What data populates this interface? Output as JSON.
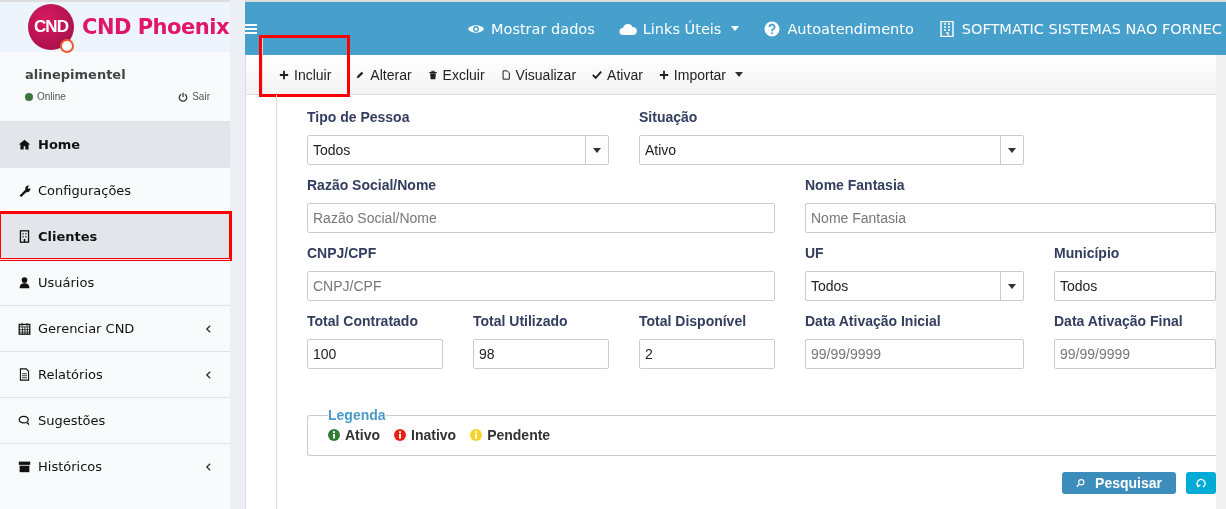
{
  "brand": {
    "logo_text": "CND",
    "name": "CND Phoenix"
  },
  "user": {
    "name": "alinepimentel",
    "status": "Online",
    "logout": "Sair"
  },
  "sidebar": {
    "items": [
      {
        "label": "Home",
        "selected": true,
        "highlighted": false,
        "submenu": false
      },
      {
        "label": "Configurações",
        "selected": false,
        "highlighted": false,
        "submenu": false
      },
      {
        "label": "Clientes",
        "selected": true,
        "highlighted": true,
        "submenu": false
      },
      {
        "label": "Usuários",
        "selected": false,
        "highlighted": false,
        "submenu": false
      },
      {
        "label": "Gerenciar CND",
        "selected": false,
        "highlighted": false,
        "submenu": true
      },
      {
        "label": "Relatórios",
        "selected": false,
        "highlighted": false,
        "submenu": true
      },
      {
        "label": "Sugestões",
        "selected": false,
        "highlighted": false,
        "submenu": false
      },
      {
        "label": "Históricos",
        "selected": false,
        "highlighted": false,
        "submenu": true
      }
    ]
  },
  "navbar": {
    "items": [
      {
        "label": "Mostrar dados",
        "dropdown": false
      },
      {
        "label": "Links Úteis",
        "dropdown": true
      },
      {
        "label": "Autoatendimento",
        "dropdown": false
      },
      {
        "label": "SOFTMATIC SISTEMAS NAO FORNEC",
        "dropdown": false
      }
    ]
  },
  "toolbar": [
    {
      "label": "Incluir",
      "highlighted": true,
      "dropdown": false
    },
    {
      "label": "Alterar",
      "highlighted": false,
      "dropdown": false
    },
    {
      "label": "Excluir",
      "highlighted": false,
      "dropdown": false
    },
    {
      "label": "Visualizar",
      "highlighted": false,
      "dropdown": false
    },
    {
      "label": "Ativar",
      "highlighted": false,
      "dropdown": false
    },
    {
      "label": "Importar",
      "highlighted": false,
      "dropdown": true
    }
  ],
  "form": {
    "fields": [
      {
        "label": "Tipo de Pessoa",
        "kind": "select",
        "value": "Todos"
      },
      {
        "label": "Situação",
        "kind": "select",
        "value": "Ativo"
      },
      {
        "label": "Razão Social/Nome",
        "kind": "input",
        "placeholder": "Razão Social/Nome"
      },
      {
        "label": "Nome Fantasia",
        "kind": "input",
        "placeholder": "Nome Fantasia"
      },
      {
        "label": "CNPJ/CPF",
        "kind": "input",
        "placeholder": "CNPJ/CPF"
      },
      {
        "label": "UF",
        "kind": "select",
        "value": "Todos"
      },
      {
        "label": "Município",
        "kind": "input",
        "value": "Todos"
      },
      {
        "label": "Total Contratado",
        "kind": "input",
        "value": "100"
      },
      {
        "label": "Total Utilizado",
        "kind": "input",
        "value": "98"
      },
      {
        "label": "Total Disponível",
        "kind": "input",
        "value": "2"
      },
      {
        "label": "Data Ativação Inicial",
        "kind": "input",
        "placeholder": "99/99/9999"
      },
      {
        "label": "Data Ativação Final",
        "kind": "input",
        "placeholder": "99/99/9999"
      }
    ]
  },
  "legend": {
    "title": "Legenda",
    "items": [
      {
        "label": "Ativo",
        "color": "#2e7d32"
      },
      {
        "label": "Inativo",
        "color": "#e8210f"
      },
      {
        "label": "Pendente",
        "color": "#f5d327"
      }
    ]
  },
  "actions": [
    {
      "label": "Pesquisar",
      "kind": "search"
    },
    {
      "kind": "refresh"
    }
  ]
}
